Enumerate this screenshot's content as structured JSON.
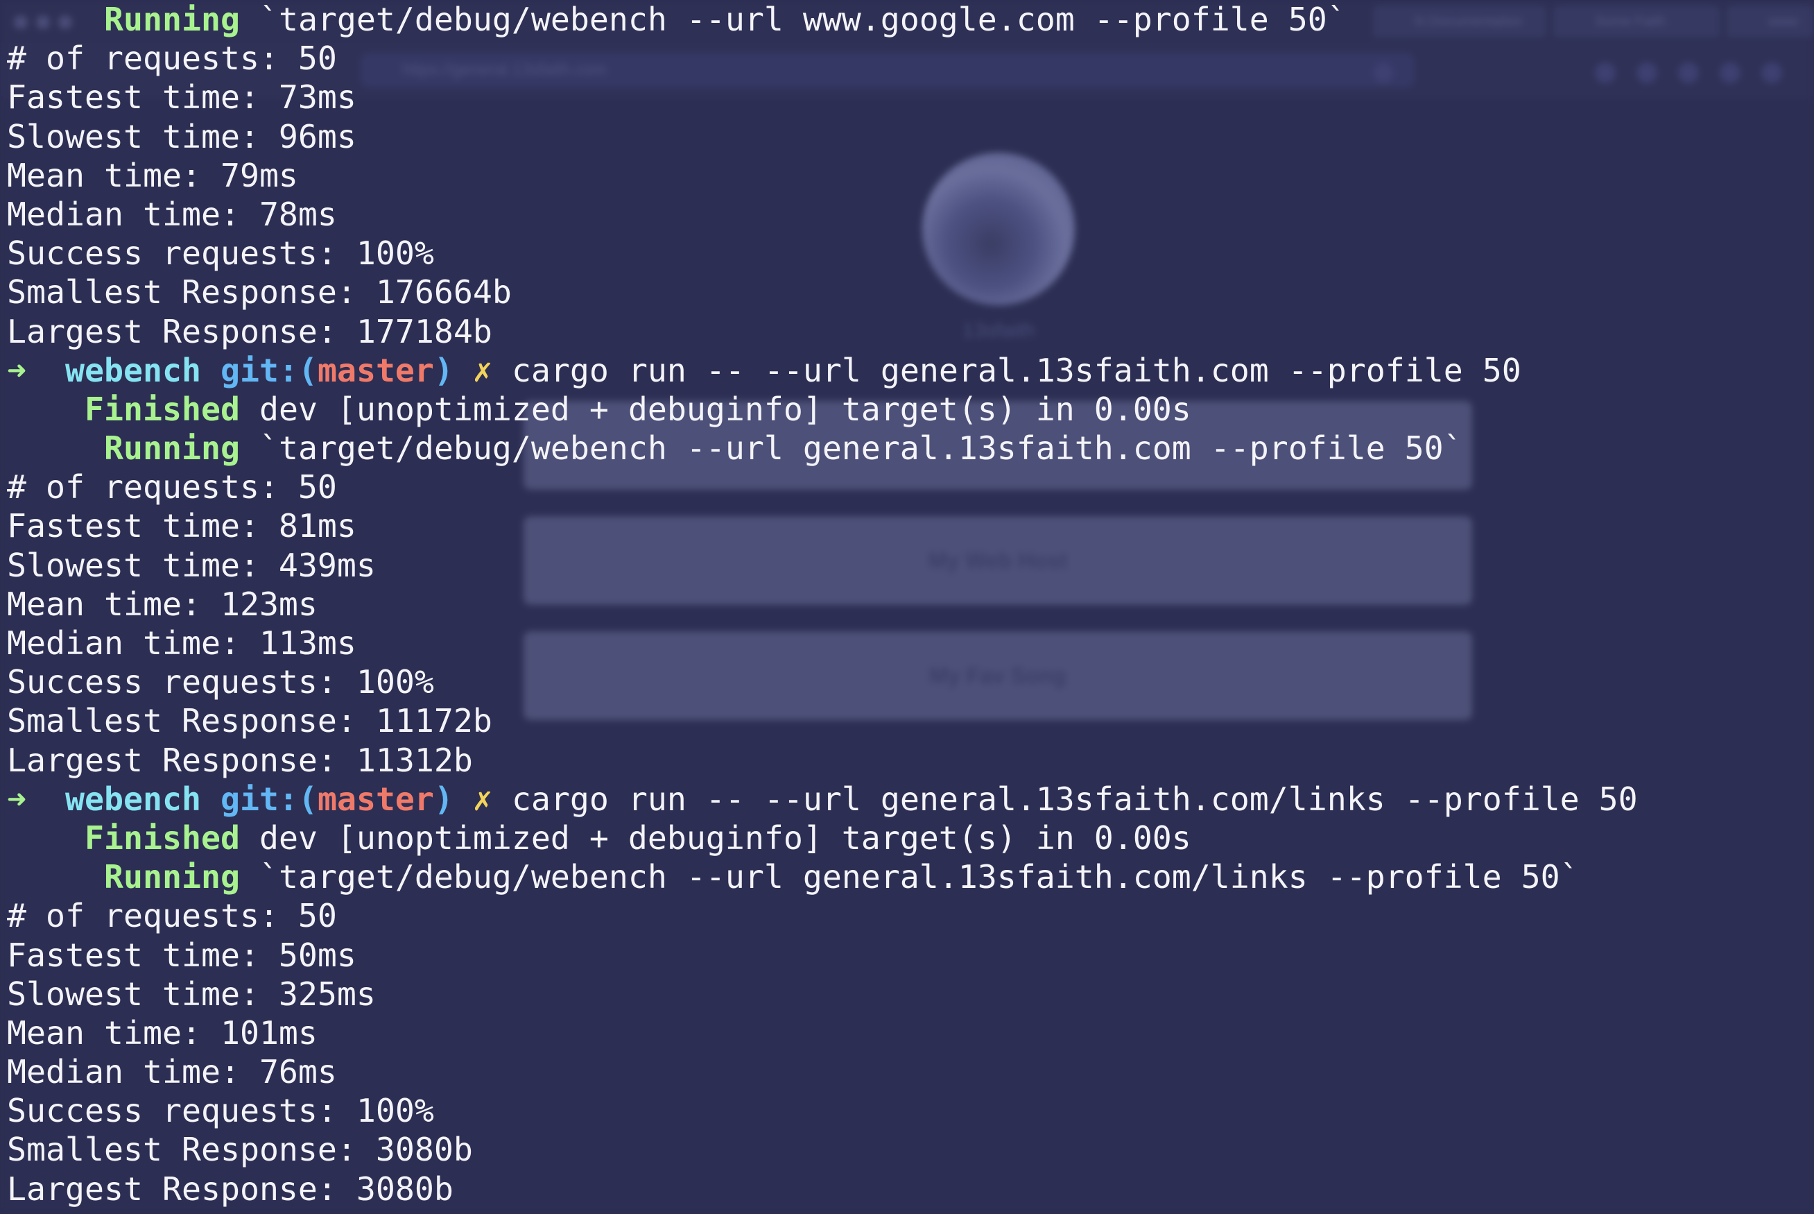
{
  "background": {
    "browser": {
      "tabs": [
        "hi Documentation",
        "Some Faith",
        "www"
      ],
      "url": "https://general.13sfaith.com",
      "profile_handle": "13sfaith",
      "link_buttons": [
        "",
        "My Web Host",
        "My Fav Song"
      ]
    }
  },
  "colors": {
    "background": "#2b2d52",
    "text": "#f4f4f8",
    "cargo_status": "#a8f28f",
    "prompt_dir": "#86e3f2",
    "git_label": "#62b7f4",
    "git_branch": "#f07a6a",
    "git_dirty": "#f3d35a"
  },
  "terminal": {
    "lines": [
      {
        "indent": "     ",
        "status": "Running",
        "text": " `target/debug/webench --url www.google.com --profile 50`"
      },
      {
        "text": "# of requests: 50"
      },
      {
        "text": "Fastest time: 73ms"
      },
      {
        "text": "Slowest time: 96ms"
      },
      {
        "text": "Mean time: 79ms"
      },
      {
        "text": "Median time: 78ms"
      },
      {
        "text": "Success requests: 100%"
      },
      {
        "text": "Smallest Response: 176664b"
      },
      {
        "text": "Largest Response: 177184b"
      },
      {
        "prompt": {
          "arrow": "➜",
          "dir": "webench",
          "git_label": "git:(",
          "branch": "master",
          "git_close": ")",
          "dirty": "✗",
          "command": "cargo run -- --url general.13sfaith.com --profile 50"
        }
      },
      {
        "indent": "    ",
        "status": "Finished",
        "text": " dev [unoptimized + debuginfo] target(s) in 0.00s"
      },
      {
        "indent": "     ",
        "status": "Running",
        "text": " `target/debug/webench --url general.13sfaith.com --profile 50`"
      },
      {
        "text": "# of requests: 50"
      },
      {
        "text": "Fastest time: 81ms"
      },
      {
        "text": "Slowest time: 439ms"
      },
      {
        "text": "Mean time: 123ms"
      },
      {
        "text": "Median time: 113ms"
      },
      {
        "text": "Success requests: 100%"
      },
      {
        "text": "Smallest Response: 11172b"
      },
      {
        "text": "Largest Response: 11312b"
      },
      {
        "prompt": {
          "arrow": "➜",
          "dir": "webench",
          "git_label": "git:(",
          "branch": "master",
          "git_close": ")",
          "dirty": "✗",
          "command": "cargo run -- --url general.13sfaith.com/links --profile 50"
        }
      },
      {
        "indent": "    ",
        "status": "Finished",
        "text": " dev [unoptimized + debuginfo] target(s) in 0.00s"
      },
      {
        "indent": "     ",
        "status": "Running",
        "text": " `target/debug/webench --url general.13sfaith.com/links --profile 50`"
      },
      {
        "text": "# of requests: 50"
      },
      {
        "text": "Fastest time: 50ms"
      },
      {
        "text": "Slowest time: 325ms"
      },
      {
        "text": "Mean time: 101ms"
      },
      {
        "text": "Median time: 76ms"
      },
      {
        "text": "Success requests: 100%"
      },
      {
        "text": "Smallest Response: 3080b"
      },
      {
        "text": "Largest Response: 3080b"
      }
    ]
  }
}
